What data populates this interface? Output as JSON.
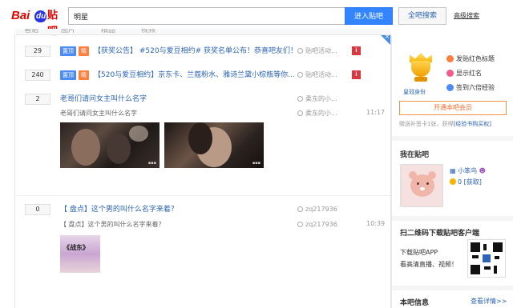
{
  "header": {
    "logo_bai": "Bai",
    "logo_du": "du",
    "logo_tieba": "贴吧",
    "search_value": "明星",
    "enter_button": "进入贴吧",
    "search_all_button": "全吧搜索",
    "advanced_link": "高级搜索"
  },
  "tabs": [
    "看贴",
    "图片",
    "精品",
    "视频"
  ],
  "threads": [
    {
      "reply_count": "29",
      "tags": [
        "置顶",
        "精"
      ],
      "title": "【获奖公告】 #520与爱豆相约# 获奖名单公布！恭喜吧友们！",
      "author": "贴吧活动..."
    },
    {
      "reply_count": "240",
      "tags": [
        "置顶",
        "精"
      ],
      "title": "【520与爱豆相约】京东卡、兰蔻粉水、雅诗兰黛小棕瓶等你...",
      "author": "贴吧活动..."
    },
    {
      "reply_count": "2",
      "title": "老哥们请问女主叫什么名字",
      "author": "柔东的小...",
      "abstract": "老哥们请问女主叫什么名字",
      "last_author": "柔东的小...",
      "time": "11:17"
    },
    {
      "reply_count": "0",
      "title": "【 盘点】这个男的叫什么名字来着？",
      "author": "zq217936",
      "abstract": "【 盘点】这个男的叫什么名字来着？",
      "last_author": "zq217936",
      "time": "10:39",
      "thumb_text": "《战东》"
    }
  ],
  "sidebar": {
    "crown_label": "皇冠身份",
    "perks": [
      "发贴红色标题",
      "显示红名",
      "签到六倍经验"
    ],
    "member_button": "开通本吧会员",
    "renew_text": "赠送补签卡1张，获得",
    "renew_link": "[经验书购买权]",
    "my_tieba_title": "我在贴吧",
    "username": "小笨鸟",
    "level_text": "0",
    "level_link": "[获取]",
    "qr_title": "扫二维码下载贴吧客户端",
    "download_line1": "下载贴吧APP",
    "download_line2": "看高清直播、视频！",
    "info_title": "本吧信息",
    "more_link": "查看详情>>"
  }
}
